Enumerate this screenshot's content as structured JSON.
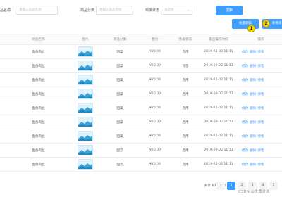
{
  "filters": {
    "name_label": "品名称",
    "name_placeholder": "请输入商品名称",
    "category_label": "商品分类",
    "category_placeholder": "请输入商品名称",
    "status_label": "商家状态",
    "status_placeholder": "请选择",
    "search_button": "搜索"
  },
  "actions": {
    "batch_delete": "批量删除",
    "add": "新增商",
    "badge_2": "2",
    "badge_1": "1"
  },
  "table": {
    "headers": [
      "商品名称",
      "图片",
      "商品分类",
      "售价",
      "售卖状态",
      "最后操作时间",
      "操作"
    ],
    "rows": [
      {
        "name": "鱼香肉丝",
        "category": "国菜",
        "price": "¥20.00",
        "status": "启用",
        "time": "2019-02-02 11:11",
        "actions": [
          "修改",
          "删除",
          "停售"
        ]
      },
      {
        "name": "鱼香肉丝",
        "category": "国菜",
        "price": "¥20.00",
        "status": "停售",
        "time": "2019-02-02 11:11",
        "actions": [
          "修改",
          "删除",
          "停售"
        ]
      },
      {
        "name": "鱼香肉丝",
        "category": "国菜",
        "price": "¥20.00",
        "status": "启用",
        "time": "2019-02-02 11:11",
        "actions": [
          "修改",
          "删除",
          "停售"
        ]
      },
      {
        "name": "鱼香肉丝",
        "category": "国菜",
        "price": "¥20.00",
        "status": "启用",
        "time": "2019-02-02 11:11",
        "actions": [
          "修改",
          "删除",
          "停售"
        ]
      },
      {
        "name": "鱼香肉丝",
        "category": "国菜",
        "price": "¥20.00",
        "status": "启用",
        "time": "2019-02-02 11:11",
        "actions": [
          "修改",
          "删除",
          "停售"
        ]
      },
      {
        "name": "鱼香肉丝",
        "category": "国菜",
        "price": "¥20.00",
        "status": "启用",
        "time": "2019-02-02 11:11",
        "actions": [
          "修改",
          "删除",
          "停售"
        ]
      },
      {
        "name": "鱼香肉丝",
        "category": "国菜",
        "price": "¥20.00",
        "status": "启用",
        "time": "2019-02-02 11:11",
        "actions": [
          "修改",
          "删除",
          "停售"
        ]
      },
      {
        "name": "鱼香肉丝",
        "category": "国菜",
        "price": "¥20.00",
        "status": "启用",
        "time": "2019-02-02 11:11",
        "actions": [
          "修改",
          "删除",
          "停售"
        ]
      },
      {
        "name": "鱼香肉丝",
        "category": "国菜",
        "price": "¥20.00",
        "status": "启用",
        "time": "2019-02-02 11:11",
        "actions": [
          "修改",
          "删除",
          "停售"
        ]
      }
    ]
  },
  "pagination": {
    "total": "共计 63 个项目",
    "prev": "‹",
    "pages": [
      "1",
      "2",
      "3",
      "4",
      "5"
    ],
    "active": "1"
  },
  "watermark": "CSDN @失重外太",
  "colors": {
    "primary": "#409eff",
    "badge": "#f5d90a"
  }
}
